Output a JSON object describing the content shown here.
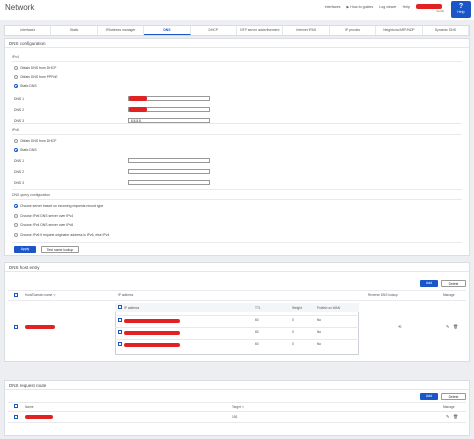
{
  "header": {
    "title": "Network",
    "links": [
      "Interfaces",
      "How-to guides",
      "Log viewer",
      "Help"
    ],
    "subtitle": "Serial",
    "help_label": "Help"
  },
  "tabs": [
    {
      "label": "Interfaces"
    },
    {
      "label": "Static"
    },
    {
      "label": "IPAddress manager"
    },
    {
      "label": "DNS",
      "active": true
    },
    {
      "label": "DHCP"
    },
    {
      "label": "NTP server advertisement"
    },
    {
      "label": "Internet IPAS"
    },
    {
      "label": "IP proxies"
    },
    {
      "label": "Neighbors/ARP/NDP"
    },
    {
      "label": "Dynamic DNS"
    }
  ],
  "dns_config": {
    "title": "DNS configuration",
    "ipv4_label": "IPv4",
    "ipv4_options": [
      "Obtain DNS from DHCP",
      "Obtain DNS from PPPoE",
      "Static DNS"
    ],
    "ipv4_selected": 2,
    "dns_fields": [
      {
        "label": "DNS 1",
        "value": ""
      },
      {
        "label": "DNS 2",
        "value": ""
      },
      {
        "label": "DNS 3",
        "value": "8.8.8.8"
      }
    ],
    "ipv6_label": "IPv6",
    "ipv6_options": [
      "Obtain DNS from DHCP",
      "Static DNS"
    ],
    "ipv6_selected": 1,
    "dns6_fields": [
      {
        "label": "DNS 1",
        "value": ""
      },
      {
        "label": "DNS 2",
        "value": ""
      },
      {
        "label": "DNS 3",
        "value": ""
      }
    ],
    "query_label": "DNS query configuration",
    "query_options": [
      "Choose server based on incoming requests record type",
      "Choose IPv6 DNS server over IPv4",
      "Choose IPv4 DNS server over IPv6",
      "Choose IPv6 if request originator address is IPv6, else IPv4"
    ],
    "query_selected": 0,
    "apply_label": "Apply",
    "test_label": "Test name lookup"
  },
  "host_entry": {
    "title": "DNS host entry",
    "add_label": "Add",
    "delete_label": "Delete",
    "columns": [
      "Host/Domain name",
      "IP address",
      "Reverse DNS lookup",
      "Manage"
    ],
    "sub_columns": [
      "IP address",
      "TTL",
      "Weight",
      "Publish on WAN"
    ],
    "rows": [
      {
        "ttl": "60",
        "weight": "0",
        "publish": "No"
      },
      {
        "ttl": "60",
        "weight": "0",
        "publish": "No"
      },
      {
        "ttl": "60",
        "weight": "0",
        "publish": "No"
      }
    ],
    "reverse_icon": "toggle-icon"
  },
  "request_route": {
    "title": "DNS request route",
    "add_label": "Add",
    "delete_label": "Delete",
    "columns": [
      "Name",
      "Target",
      "Manage"
    ],
    "rows": [
      {
        "target": "192."
      }
    ]
  },
  "colors": {
    "accent": "#1a56c8",
    "redaction": "#e22222"
  }
}
